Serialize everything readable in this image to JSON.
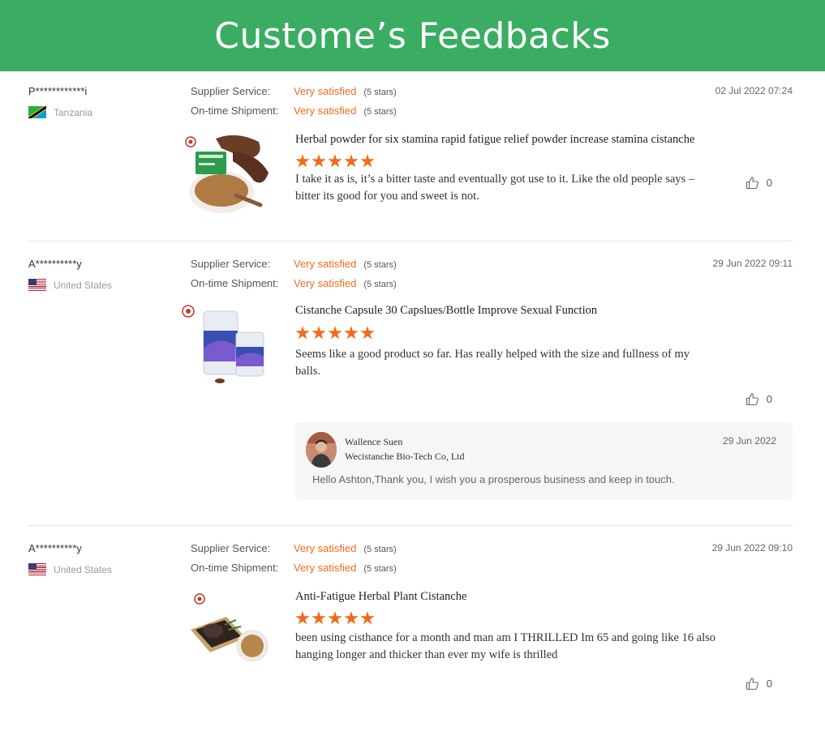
{
  "header": {
    "title": "Custome’s Feedbacks"
  },
  "labels": {
    "supplier_service": "Supplier Service:",
    "ontime_shipment": "On-time Shipment:"
  },
  "colors": {
    "banner": "#3aad62",
    "accent": "#f26b1d"
  },
  "reviews": [
    {
      "buyer": "P************i",
      "country": "Tanzania",
      "flag_icon": "tanzania-flag-icon",
      "date": "02 Jul 2022 07:24",
      "supplier_service": "Very satisfied",
      "supplier_service_stars": "(5 stars)",
      "ontime_shipment": "Very satisfied",
      "ontime_shipment_stars": "(5 stars)",
      "product": "Herbal powder for six stamina rapid fatigue relief powder increase stamina cistanche",
      "rating": 5,
      "text": "I take it as is, it’s a bitter taste and eventually got use to it. Like the old people says – bitter its good for you and sweet is not.",
      "likes": "0"
    },
    {
      "buyer": "A**********y",
      "country": "United States",
      "flag_icon": "us-flag-icon",
      "date": "29 Jun 2022 09:11",
      "supplier_service": "Very satisfied",
      "supplier_service_stars": "(5 stars)",
      "ontime_shipment": "Very satisfied",
      "ontime_shipment_stars": "(5 stars)",
      "product": "Cistanche Capsule 30 Capslues/Bottle Improve Sexual Function",
      "rating": 5,
      "text": "Seems like a good product so far. Has really helped with the size and fullness of my balls.",
      "likes": "0",
      "reply": {
        "name": "Wallence Suen",
        "company": "Wecistanche Bio-Tech Co, Ltd",
        "date": "29 Jun 2022",
        "text": "Hello Ashton,Thank you, I wish you a prosperous business and keep in touch."
      }
    },
    {
      "buyer": "A**********y",
      "country": "United States",
      "flag_icon": "us-flag-icon",
      "date": "29 Jun 2022 09:10",
      "supplier_service": "Very satisfied",
      "supplier_service_stars": "(5 stars)",
      "ontime_shipment": "Very satisfied",
      "ontime_shipment_stars": "(5 stars)",
      "product": "Anti-Fatigue Herbal Plant Cistanche",
      "rating": 5,
      "text": "been using cisthance for a month and man am I THRILLED Im 65 and going like 16 also hanging longer and thicker than ever my wife is thrilled",
      "likes": "0"
    }
  ]
}
